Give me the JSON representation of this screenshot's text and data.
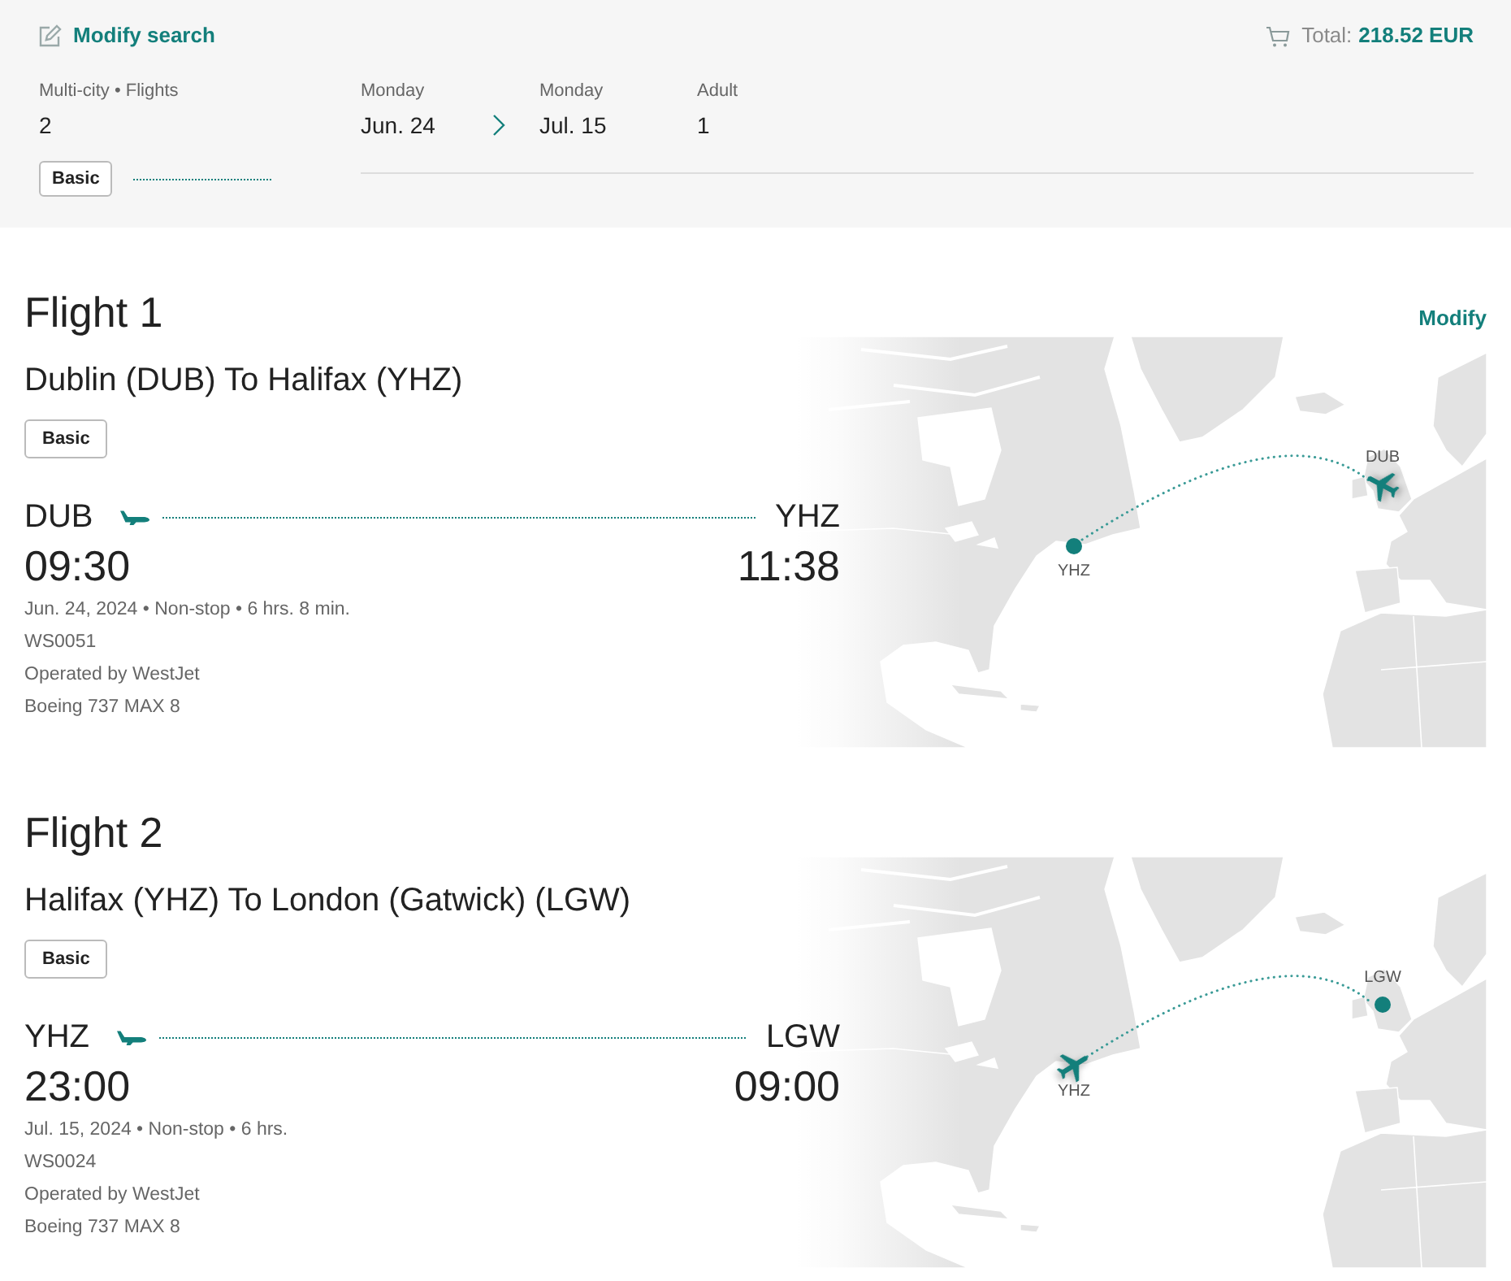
{
  "header": {
    "modify_link": "Modify search",
    "total_label": "Total:",
    "total_value": "218.52 EUR",
    "trip_summary": "Multi-city • Flights",
    "flight_count": "2",
    "fare_tag": "Basic",
    "dates": [
      {
        "weekday": "Monday",
        "date": "Jun. 24"
      },
      {
        "weekday": "Monday",
        "date": "Jul. 15"
      }
    ],
    "passengers": {
      "label": "Adult",
      "count": "1"
    }
  },
  "flights": [
    {
      "title": "Flight 1",
      "modify_link": "Modify",
      "route": "Dublin (DUB) To Halifax (YHZ)",
      "fare_tag": "Basic",
      "departure": {
        "code": "DUB",
        "time": "09:30"
      },
      "arrival": {
        "code": "YHZ",
        "time": "11:38"
      },
      "summary": "Jun. 24, 2024 • Non-stop • 6 hrs. 8 min.",
      "flight_number": "WS0051",
      "operator": "Operated by WestJet",
      "aircraft": "Boeing 737 MAX 8",
      "map": {
        "westbound": true,
        "origin_label": "DUB",
        "destination_label": "YHZ"
      }
    },
    {
      "title": "Flight 2",
      "route": "Halifax (YHZ) To London (Gatwick) (LGW)",
      "fare_tag": "Basic",
      "departure": {
        "code": "YHZ",
        "time": "23:00"
      },
      "arrival": {
        "code": "LGW",
        "time": "09:00"
      },
      "summary": "Jul. 15, 2024 • Non-stop • 6 hrs.",
      "flight_number": "WS0024",
      "operator": "Operated by WestJet",
      "aircraft": "Boeing 737 MAX 8",
      "map": {
        "westbound": false,
        "origin_label": "YHZ",
        "destination_label": "LGW"
      }
    }
  ]
}
